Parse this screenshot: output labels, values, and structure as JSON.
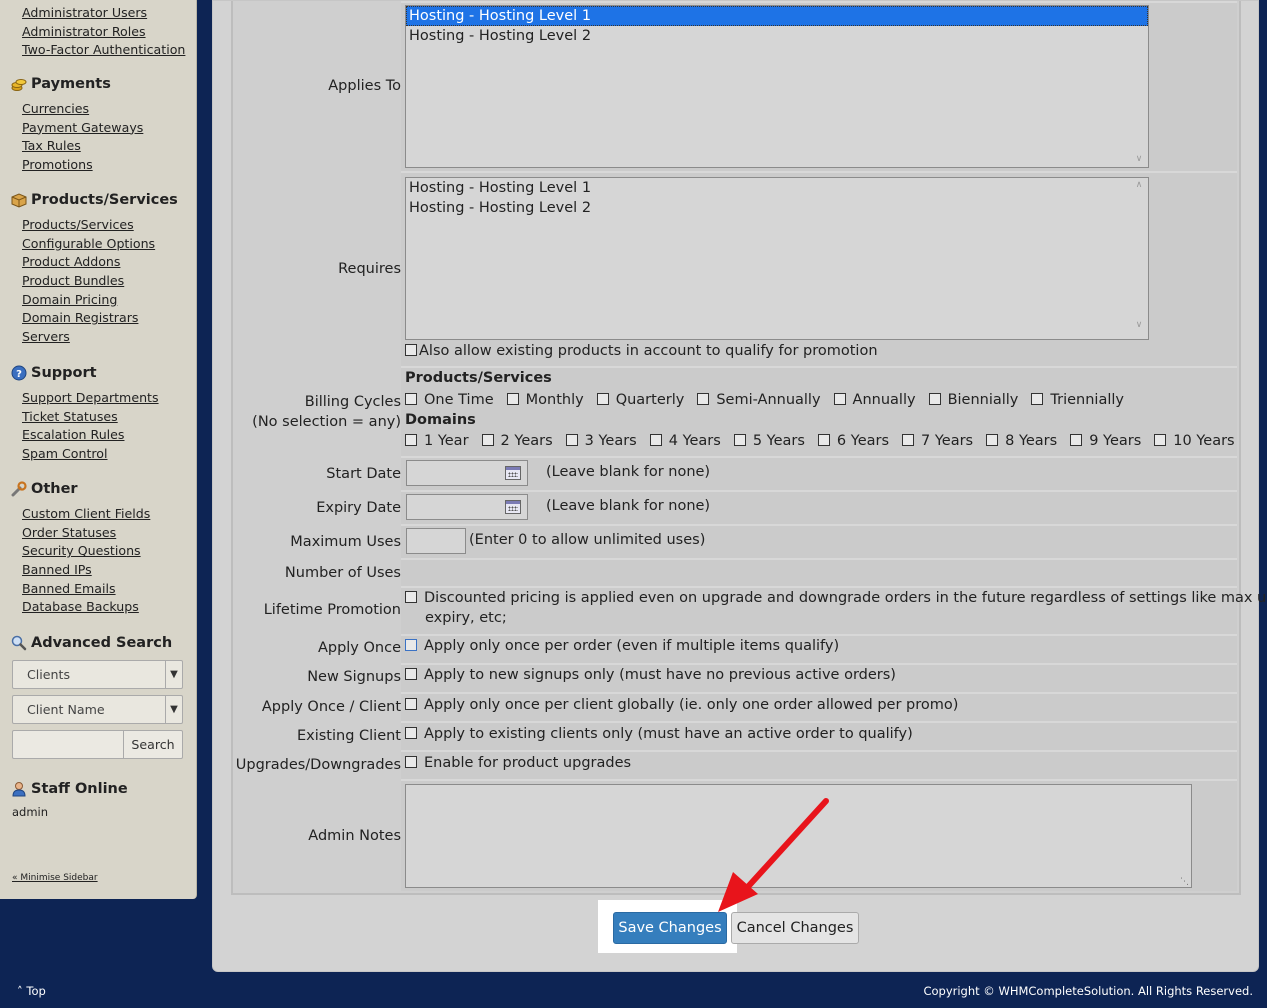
{
  "sidebar": {
    "top_links": [
      "Administrator Users",
      "Administrator Roles",
      "Two-Factor Authentication"
    ],
    "groups": [
      {
        "title": "Payments",
        "icon": "coins-icon",
        "links": [
          "Currencies",
          "Payment Gateways",
          "Tax Rules",
          "Promotions"
        ]
      },
      {
        "title": "Products/Services",
        "icon": "box-icon",
        "links": [
          "Products/Services",
          "Configurable Options",
          "Product Addons",
          "Product Bundles",
          "Domain Pricing",
          "Domain Registrars",
          "Servers"
        ]
      },
      {
        "title": "Support",
        "icon": "help-icon",
        "links": [
          "Support Departments",
          "Ticket Statuses",
          "Escalation Rules",
          "Spam Control"
        ]
      },
      {
        "title": "Other",
        "icon": "wrench-icon",
        "links": [
          "Custom Client Fields",
          "Order Statuses",
          "Security Questions",
          "Banned IPs",
          "Banned Emails",
          "Database Backups"
        ]
      }
    ],
    "advanced_search": {
      "title": "Advanced Search",
      "type_select": "Clients",
      "field_select": "Client Name",
      "search_button": "Search"
    },
    "staff_online": {
      "title": "Staff Online",
      "user": "admin"
    },
    "minimise": "« Minimise Sidebar"
  },
  "form": {
    "applies_to": {
      "label": "Applies To",
      "options": [
        "Hosting - Hosting Level 1",
        "Hosting - Hosting Level 2"
      ],
      "selected_index": 0
    },
    "requires": {
      "label": "Requires",
      "options": [
        "Hosting - Hosting Level 1",
        "Hosting - Hosting Level 2"
      ],
      "existing_text": "Also allow existing products in account to qualify for promotion"
    },
    "billing_cycles": {
      "label": "Billing Cycles",
      "sublabel": "(No selection = any)",
      "products_heading": "Products/Services",
      "products": [
        "One Time",
        "Monthly",
        "Quarterly",
        "Semi-Annually",
        "Annually",
        "Biennially",
        "Triennially"
      ],
      "domains_heading": "Domains",
      "domains": [
        "1 Year",
        "2 Years",
        "3 Years",
        "4 Years",
        "5 Years",
        "6 Years",
        "7 Years",
        "8 Years",
        "9 Years",
        "10 Years"
      ]
    },
    "start_date": {
      "label": "Start Date",
      "hint": "(Leave blank for none)"
    },
    "expiry_date": {
      "label": "Expiry Date",
      "hint": "(Leave blank for none)"
    },
    "max_uses": {
      "label": "Maximum Uses",
      "hint": "(Enter 0 to allow unlimited uses)"
    },
    "num_uses": {
      "label": "Number of Uses"
    },
    "lifetime": {
      "label": "Lifetime Promotion",
      "text_line1": "Discounted pricing is applied even on upgrade and downgrade orders in the future regardless of settings like max uses,",
      "text_line2": "expiry, etc;"
    },
    "apply_once": {
      "label": "Apply Once",
      "text": "Apply only once per order (even if multiple items qualify)"
    },
    "new_signups": {
      "label": "New Signups",
      "text": "Apply to new signups only (must have no previous active orders)"
    },
    "apply_once_client": {
      "label": "Apply Once / Client",
      "text": "Apply only once per client globally (ie. only one order allowed per promo)"
    },
    "existing_client": {
      "label": "Existing Client",
      "text": "Apply to existing clients only (must have an active order to qualify)"
    },
    "upgrades": {
      "label": "Upgrades/Downgrades",
      "text": "Enable for product upgrades"
    },
    "admin_notes": {
      "label": "Admin Notes"
    }
  },
  "buttons": {
    "save": "Save Changes",
    "cancel": "Cancel Changes"
  },
  "footer": {
    "top": "Top",
    "copyright": "Copyright © WHMCompleteSolution. All Rights Reserved."
  },
  "colors": {
    "page_bg": "#0d2454",
    "save_button": "#357ebd",
    "arrow": "#e8141b",
    "selected_option": "#1e73e6"
  }
}
